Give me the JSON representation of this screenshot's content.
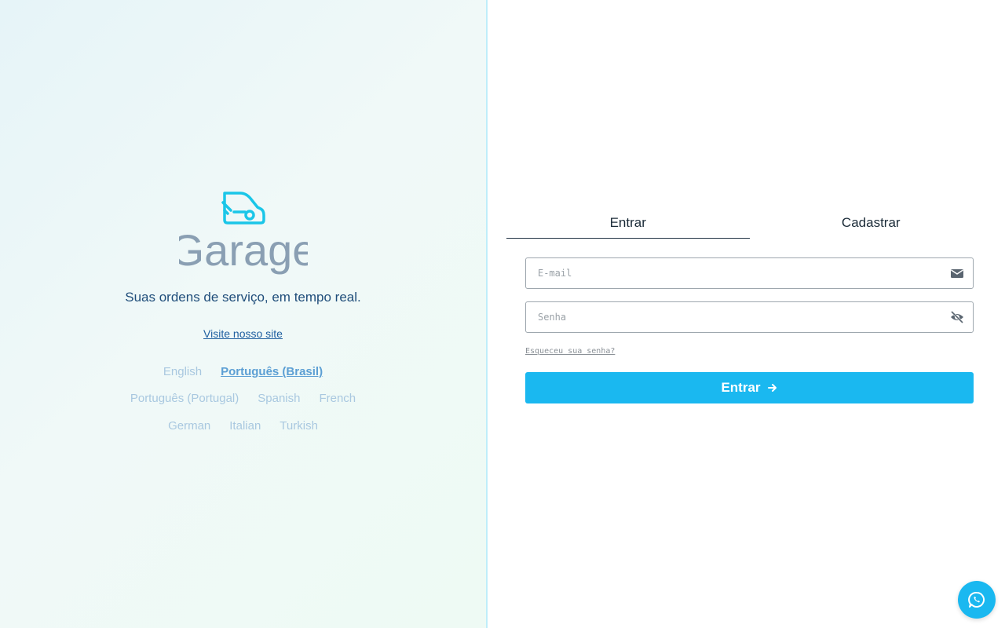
{
  "brand": {
    "name": "Garage",
    "tagline": "Suas ordens de serviço, em tempo real.",
    "site_link": "Visite nosso site",
    "accent_color": "#1ab8f0",
    "logo_color": "#8a9fb3"
  },
  "languages": {
    "row1": [
      "English",
      "Português (Brasil)"
    ],
    "row2": [
      "Português (Portugal)",
      "Spanish",
      "French"
    ],
    "row3": [
      "German",
      "Italian",
      "Turkish"
    ],
    "selected": "Português (Brasil)"
  },
  "tabs": {
    "login": "Entrar",
    "register": "Cadastrar",
    "active": "Entrar"
  },
  "form": {
    "email_placeholder": "E-mail",
    "email_value": "",
    "password_placeholder": "Senha",
    "password_value": "",
    "forgot": "Esqueceu sua senha?",
    "submit": "Entrar"
  },
  "icons": {
    "email": "envelope-icon",
    "password": "eye-slash-icon",
    "submit": "arrow-right-icon",
    "chat": "whatsapp-icon"
  }
}
